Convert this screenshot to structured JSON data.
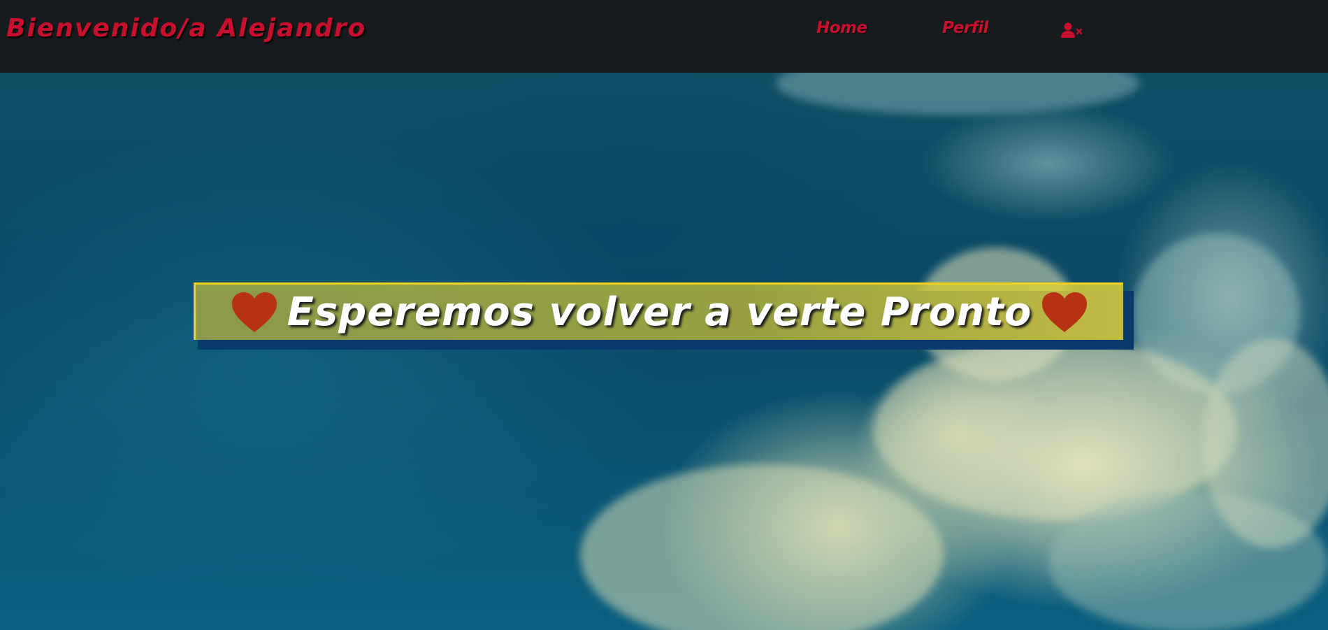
{
  "navbar": {
    "brand": "Bienvenido/a Alejandro",
    "links": {
      "home": "Home",
      "perfil": "Perfil"
    },
    "logout_icon": "user-xmark-icon"
  },
  "hero": {
    "banner_text": "Esperemos volver a verte Pronto",
    "left_icon": "heart-icon",
    "right_icon": "heart-icon",
    "background": "clouds-sky-image"
  },
  "colors": {
    "brand_red": "#c8102e",
    "nav_bg": "#181b1e",
    "banner_border": "#f0d21a",
    "banner_shadow": "#0a3a6e",
    "heart": "#b53212"
  }
}
